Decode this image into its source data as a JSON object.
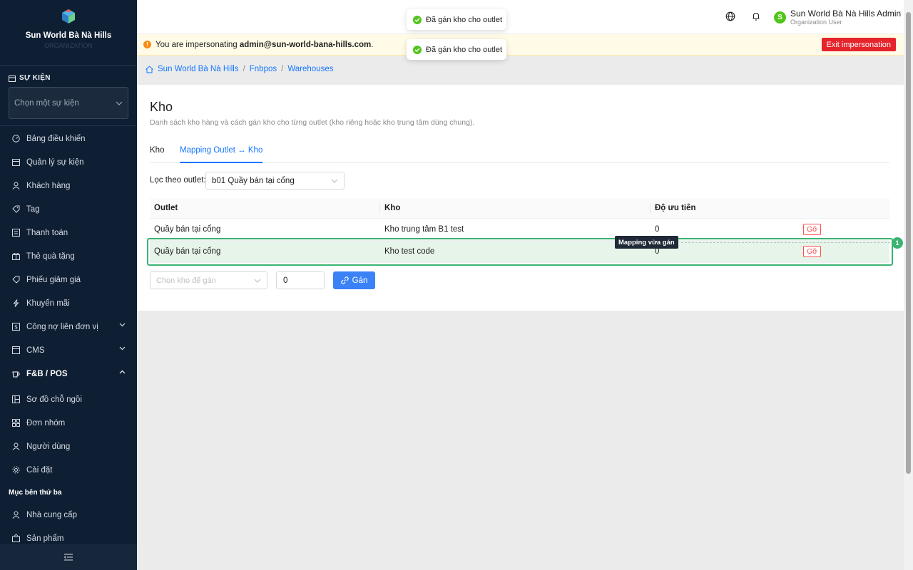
{
  "sidebar": {
    "brand_name": "Sun World Bà Nà Hills",
    "brand_sub": "ORGANIZATION",
    "event_section_label": "SỰ KIỆN",
    "event_select_placeholder": "Chọn một sự kiện",
    "items": [
      {
        "label": "Bảng điều khiển",
        "icon": "dashboard-icon"
      },
      {
        "label": "Quản lý sự kiện",
        "icon": "calendar-icon"
      },
      {
        "label": "Khách hàng",
        "icon": "user-icon"
      },
      {
        "label": "Tag",
        "icon": "tag-icon"
      },
      {
        "label": "Thanh toán",
        "icon": "payment-icon"
      },
      {
        "label": "Thẻ quà tặng",
        "icon": "gift-icon"
      },
      {
        "label": "Phiếu giảm giá",
        "icon": "coupon-icon"
      },
      {
        "label": "Khuyến mãi",
        "icon": "flash-icon"
      },
      {
        "label": "Công nợ liên đơn vị",
        "icon": "debt-icon"
      },
      {
        "label": "CMS",
        "icon": "cms-icon"
      },
      {
        "label": "F&B / POS",
        "icon": "coffee-icon"
      },
      {
        "label": "Sơ đồ chỗ ngồi",
        "icon": "seat-map-icon"
      },
      {
        "label": "Đơn nhóm",
        "icon": "grid-icon"
      },
      {
        "label": "Người dùng",
        "icon": "person-icon"
      },
      {
        "label": "Cài đặt",
        "icon": "gear-icon"
      }
    ],
    "third_party_label": "Mục bên thứ ba",
    "third_party_items": [
      {
        "label": "Nhà cung cấp",
        "icon": "supplier-icon"
      },
      {
        "label": "Sản phẩm",
        "icon": "product-icon"
      }
    ]
  },
  "header": {
    "user_initial": "S",
    "user_name": "Sun World Bà Nà Hills Admin",
    "user_role": "Organization User"
  },
  "impersonation": {
    "prefix": "You are impersonating ",
    "email": "admin@sun-world-bana-hills.com",
    "suffix": ".",
    "exit_label": "Exit impersonation"
  },
  "breadcrumb": [
    "Sun World Bà Nà Hills",
    "Fnbpos",
    "Warehouses"
  ],
  "page": {
    "title": "Kho",
    "description": "Danh sách kho hàng và cách gán kho cho từng outlet (kho riêng hoặc kho trung tâm dùng chung).",
    "tabs": [
      "Kho",
      "Mapping Outlet ↔ Kho"
    ],
    "filter_label": "Lọc theo outlet:",
    "filter_value": "b01 Quầy bán tại cổng",
    "table": {
      "headers": [
        "Outlet",
        "Kho",
        "Độ ưu tiên"
      ],
      "rows": [
        {
          "outlet": "Quầy bán tại cổng",
          "kho": "Kho trung tâm B1 test",
          "priority": "0",
          "action": "Gỡ"
        },
        {
          "outlet": "Quầy bán tại cổng",
          "kho": "Kho test code",
          "priority": "0",
          "action": "Gỡ"
        }
      ]
    },
    "add": {
      "kho_placeholder": "Chọn kho để gán",
      "priority_value": "0",
      "assign_label": "Gán"
    }
  },
  "annotation": {
    "tooltip": "Mapping vừa gán",
    "badge": "1"
  },
  "toasts": [
    "Đã gán kho cho outlet",
    "Đã gán kho cho outlet"
  ],
  "colors": {
    "sidebar_bg": "#0f1f33",
    "accent": "#1677ff",
    "danger": "#e5242b",
    "success": "#52c41a",
    "highlight": "#3cb371"
  }
}
